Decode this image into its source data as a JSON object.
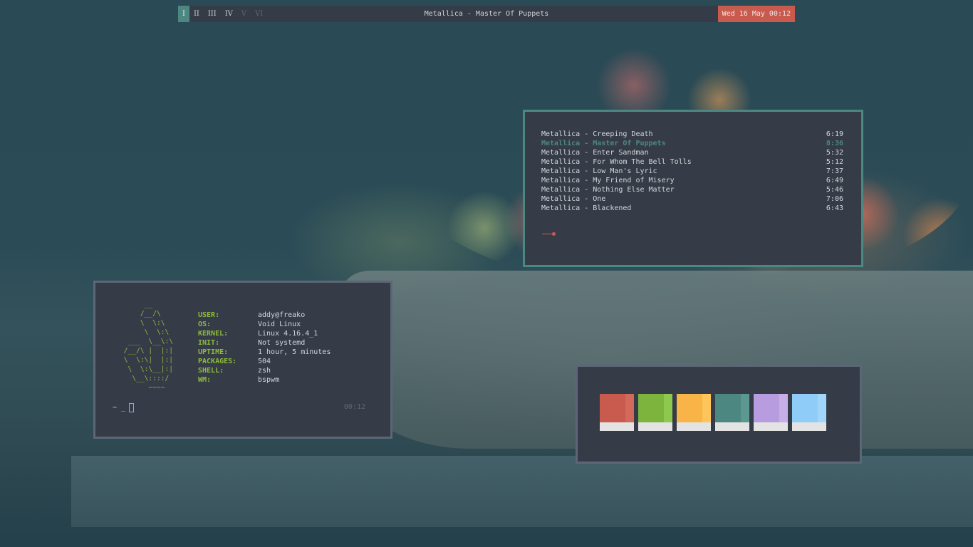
{
  "topbar": {
    "workspaces": [
      {
        "label": "I",
        "state": "active"
      },
      {
        "label": "II",
        "state": "occupied"
      },
      {
        "label": "III",
        "state": "occupied"
      },
      {
        "label": "IV",
        "state": "occupied"
      },
      {
        "label": "V",
        "state": "empty"
      },
      {
        "label": "VI",
        "state": "empty"
      }
    ],
    "now_playing": "Metallica - Master Of Puppets",
    "clock": "Wed 16 May 00:12"
  },
  "player": {
    "tracks": [
      {
        "title": "Metallica - Creeping Death",
        "duration": "6:19"
      },
      {
        "title": "Metallica - Master Of Puppets",
        "duration": "8:36",
        "playing": true
      },
      {
        "title": "Metallica - Enter Sandman",
        "duration": "5:32"
      },
      {
        "title": "Metallica - For Whom The Bell Tolls",
        "duration": "5:12"
      },
      {
        "title": "Metallica - Low Man's Lyric",
        "duration": "7:37"
      },
      {
        "title": "Metallica - My Friend of Misery",
        "duration": "6:49"
      },
      {
        "title": "Metallica - Nothing Else Matter",
        "duration": "5:46"
      },
      {
        "title": "Metallica - One",
        "duration": "7:06"
      },
      {
        "title": "Metallica - Blackened",
        "duration": "6:43"
      }
    ]
  },
  "fetch": {
    "ascii_logo": "      __\n     /__/\\\n     \\  \\:\\\n      \\  \\:\\\n  ___  \\__\\:\\\n /__/\\ |  |:|\n \\  \\:\\|  |:|\n  \\  \\:\\__|:|\n   \\__\\::::/\n       ~~~~",
    "rows": [
      {
        "key": "USER:",
        "value": "addy@freako"
      },
      {
        "key": "OS:",
        "value": "Void Linux"
      },
      {
        "key": "KERNEL:",
        "value": "Linux 4.16.4_1"
      },
      {
        "key": "INIT:",
        "value": "Not systemd"
      },
      {
        "key": "UPTIME:",
        "value": "1 hour, 5 minutes"
      },
      {
        "key": "PACKAGES:",
        "value": "504"
      },
      {
        "key": "SHELL:",
        "value": "zsh"
      },
      {
        "key": "WM:",
        "value": "bspwm"
      }
    ],
    "prompt": "~ _",
    "time": "00:12"
  },
  "palette": {
    "colors": [
      {
        "main": "#c85a4e",
        "shade": "#d26a5c"
      },
      {
        "main": "#7db43e",
        "shade": "#8ec84c"
      },
      {
        "main": "#f9b448",
        "shade": "#ffc45a"
      },
      {
        "main": "#4d8781",
        "shade": "#5b9891"
      },
      {
        "main": "#b79ddf",
        "shade": "#c6afe8"
      },
      {
        "main": "#8fccf7",
        "shade": "#a1d6fa"
      }
    ]
  },
  "theme": {
    "accent": "#4d8781",
    "alert": "#c85a4e",
    "fetch_green": "#8dbb3b",
    "bg": "#363c47"
  }
}
